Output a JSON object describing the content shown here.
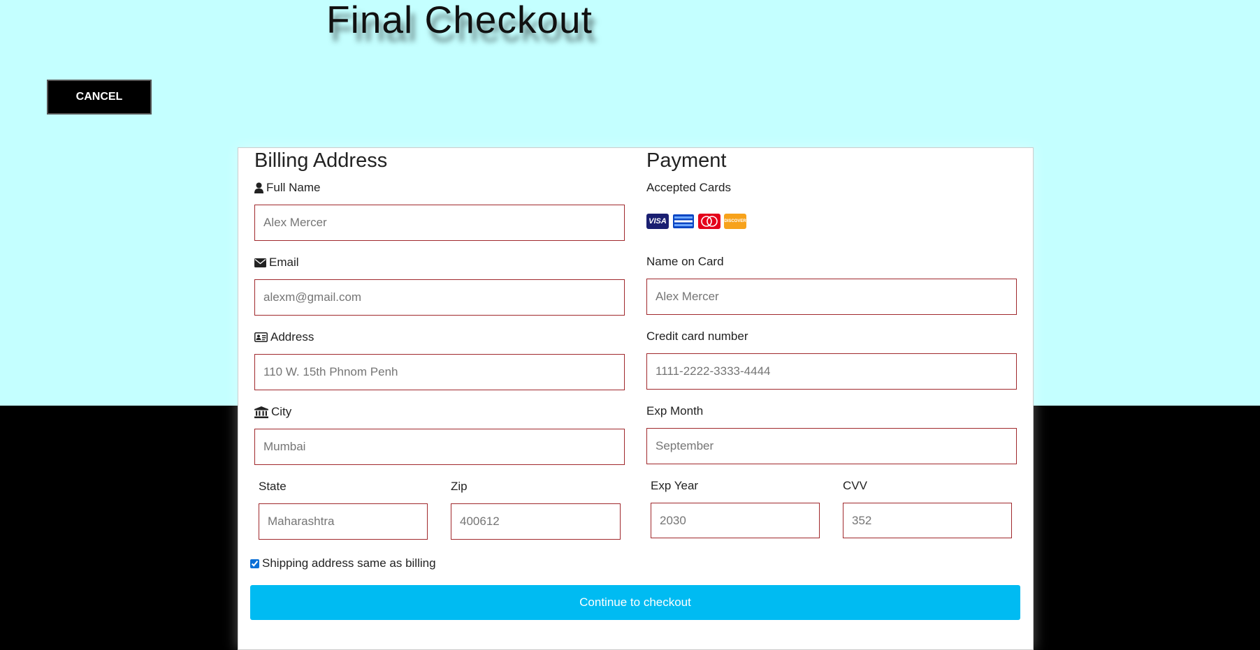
{
  "page": {
    "title": "Final Checkout",
    "cancel_label": "CANCEL"
  },
  "billing": {
    "heading": "Billing Address",
    "full_name": {
      "label": "Full Name",
      "placeholder": "Alex Mercer",
      "icon": "user-icon"
    },
    "email": {
      "label": "Email",
      "placeholder": "alexm@gmail.com",
      "icon": "envelope-icon"
    },
    "address": {
      "label": "Address",
      "placeholder": "110 W. 15th Phnom Penh",
      "icon": "address-card-icon"
    },
    "city": {
      "label": "City",
      "placeholder": "Mumbai",
      "icon": "institution-icon"
    },
    "state": {
      "label": "State",
      "placeholder": "Maharashtra"
    },
    "zip": {
      "label": "Zip",
      "placeholder": "400612"
    }
  },
  "payment": {
    "heading": "Payment",
    "accepted_cards_label": "Accepted Cards",
    "cards": [
      {
        "name": "visa-icon",
        "text": "VISA",
        "color": "#1a1f71"
      },
      {
        "name": "amex-icon",
        "color": "#0a46c4"
      },
      {
        "name": "mastercard-icon",
        "color": "#e4021b"
      },
      {
        "name": "discover-icon",
        "text": "DISCOVER",
        "color": "#f7a21b"
      }
    ],
    "name_on_card": {
      "label": "Name on Card",
      "placeholder": "Alex Mercer"
    },
    "card_number": {
      "label": "Credit card number",
      "placeholder": "1111-2222-3333-4444"
    },
    "exp_month": {
      "label": "Exp Month",
      "placeholder": "September"
    },
    "exp_year": {
      "label": "Exp Year",
      "placeholder": "2030"
    },
    "cvv": {
      "label": "CVV",
      "placeholder": "352"
    }
  },
  "shipping_same": {
    "label": "Shipping address same as billing",
    "checked": true
  },
  "submit_label": "Continue to checkout",
  "colors": {
    "top_background": "#c4ffff",
    "bottom_background": "#000000",
    "input_border": "#a0282c",
    "submit_button": "#00bbf2"
  }
}
